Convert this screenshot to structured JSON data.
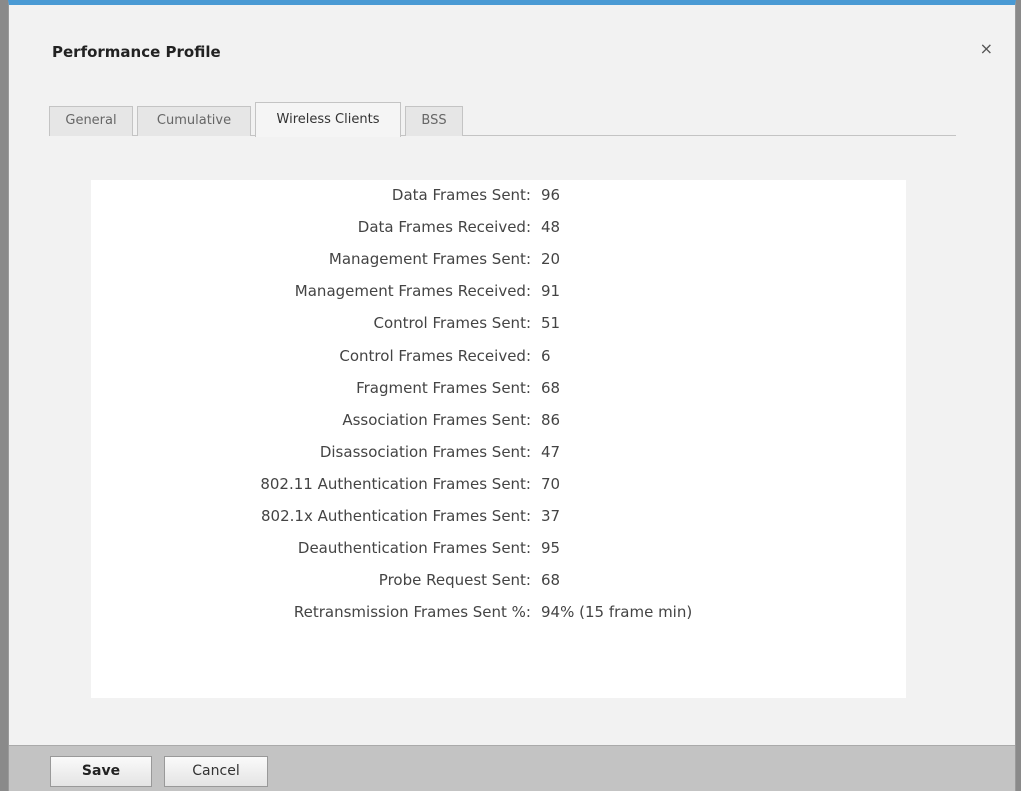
{
  "dialog": {
    "title": "Performance Profile",
    "close_glyph": "×"
  },
  "tabs": [
    {
      "label": "General"
    },
    {
      "label": "Cumulative"
    },
    {
      "label": "Wireless Clients",
      "active": true
    },
    {
      "label": "BSS"
    }
  ],
  "stats": [
    {
      "label": "Data Frames Sent:",
      "value": "96"
    },
    {
      "label": "Data Frames Received:",
      "value": "48"
    },
    {
      "label": "Management Frames Sent:",
      "value": "20"
    },
    {
      "label": "Management Frames Received:",
      "value": "91"
    },
    {
      "label": "Control Frames Sent:",
      "value": "51"
    },
    {
      "label": "Control Frames Received:",
      "value": "6"
    },
    {
      "label": "Fragment Frames Sent:",
      "value": "68"
    },
    {
      "label": "Association Frames Sent:",
      "value": "86"
    },
    {
      "label": "Disassociation Frames Sent:",
      "value": "47"
    },
    {
      "label": "802.11 Authentication Frames Sent:",
      "value": "70"
    },
    {
      "label": "802.1x Authentication Frames Sent:",
      "value": "37"
    },
    {
      "label": "Deauthentication Frames Sent:",
      "value": "95"
    },
    {
      "label": "Probe Request Sent:",
      "value": "68"
    },
    {
      "label": "Retransmission Frames Sent %:",
      "value": "94% (15 frame min)"
    }
  ],
  "footer": {
    "save_label": "Save",
    "cancel_label": "Cancel"
  },
  "colors": {
    "accent": "#4a9ad4",
    "footer_bg": "#c3c3c3"
  }
}
